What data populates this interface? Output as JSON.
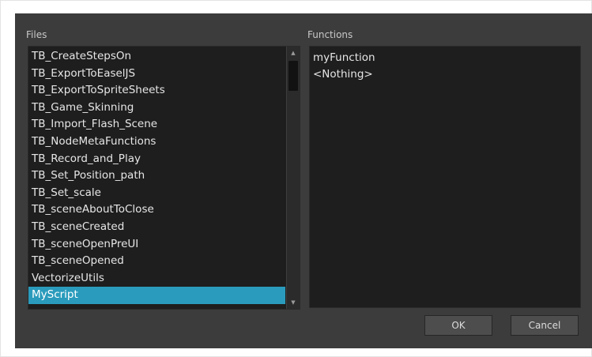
{
  "files": {
    "label": "Files",
    "items": [
      "TB_CreateStepsOn",
      "TB_ExportToEaselJS",
      "TB_ExportToSpriteSheets",
      "TB_Game_Skinning",
      "TB_Import_Flash_Scene",
      "TB_NodeMetaFunctions",
      "TB_Record_and_Play",
      "TB_Set_Position_path",
      "TB_Set_scale",
      "TB_sceneAboutToClose",
      "TB_sceneCreated",
      "TB_sceneOpenPreUI",
      "TB_sceneOpened",
      "VectorizeUtils",
      "MyScript"
    ],
    "selected": "MyScript"
  },
  "functions": {
    "label": "Functions",
    "items": [
      "myFunction",
      "<Nothing>"
    ]
  },
  "buttons": {
    "ok": "OK",
    "cancel": "Cancel"
  },
  "scrollbar": {
    "up_icon": "triangle-up",
    "down_icon": "triangle-down"
  },
  "colors": {
    "dialog_bg": "#3c3c3c",
    "list_bg": "#1e1e1e",
    "selection": "#2a9bbc"
  }
}
